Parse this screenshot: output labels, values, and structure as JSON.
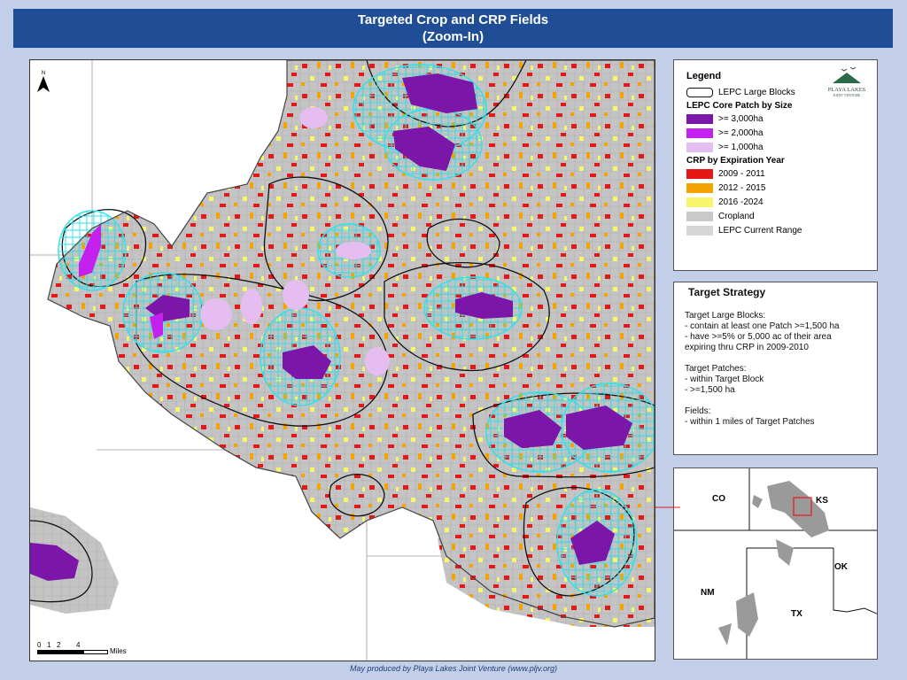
{
  "title": {
    "line1": "Targeted Crop and CRP Fields",
    "line2": "(Zoom-In)"
  },
  "map": {
    "north_label": "N",
    "scale": {
      "ticks": [
        "0",
        "1",
        "2",
        "4"
      ],
      "unit": "Miles"
    }
  },
  "legend": {
    "title": "Legend",
    "logo_text": "PLAYA LAKES",
    "logo_subtext": "JOINT VENTURE",
    "large_blocks": "LEPC Large Blocks",
    "core_heading": "LEPC Core Patch by Size",
    "core_items": [
      {
        "label": ">= 3,000ha",
        "color": "#7b16a8"
      },
      {
        "label": ">= 2,000ha",
        "color": "#c421ee"
      },
      {
        "label": ">= 1,000ha",
        "color": "#e6bdf0"
      }
    ],
    "crp_heading": "CRP by Expiration Year",
    "crp_items": [
      {
        "label": "2009 - 2011",
        "color": "#e81717"
      },
      {
        "label": "2012 - 2015",
        "color": "#f5a300"
      },
      {
        "label": "2016 -2024",
        "color": "#f8f56a"
      }
    ],
    "cropland": {
      "label": "Cropland",
      "color": "#c9c9c9"
    },
    "range": {
      "label": "LEPC Current Range",
      "color": "#d6d6d6"
    }
  },
  "strategy": {
    "title": "Target Strategy",
    "blocks_heading": "Target Large Blocks:",
    "blocks_line1": "-  contain at least one Patch >=1,500 ha",
    "blocks_line2": "-  have >=5% or 5,000 ac of their area",
    "blocks_line3": "expiring thru CRP in 2009-2010",
    "patches_heading": "Target Patches:",
    "patches_line1": "- within Target Block",
    "patches_line2": "-  >=1,500 ha",
    "fields_heading": "Fields:",
    "fields_line1": "-  within 1 miles of Target Patches"
  },
  "inset": {
    "states": [
      "CO",
      "KS",
      "OK",
      "NM",
      "TX"
    ]
  },
  "footer": "May produced by Playa Lakes Joint Venture (www.pljv.org)"
}
